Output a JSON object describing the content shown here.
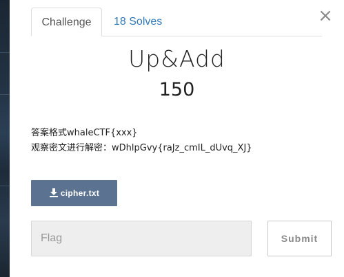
{
  "modal": {
    "close_glyph": "×",
    "tabs": [
      {
        "label": "Challenge",
        "active": true
      },
      {
        "label": "18 Solves",
        "active": false
      }
    ],
    "challenge": {
      "name": "Up&Add",
      "value": "150",
      "description_lines": [
        "答案格式whaleCTF{xxx}",
        "观察密文进行解密：wDhlpGvy{raJz_cmIL_dUvq_XJ}"
      ],
      "file_label": "cipher.txt",
      "file_icon": "download-icon"
    },
    "flag_input": {
      "placeholder": "Flag",
      "value": ""
    },
    "submit_label": "Submit"
  },
  "colors": {
    "accent": "#5b7290",
    "link": "#337ab7",
    "backdrop": "#223243"
  }
}
